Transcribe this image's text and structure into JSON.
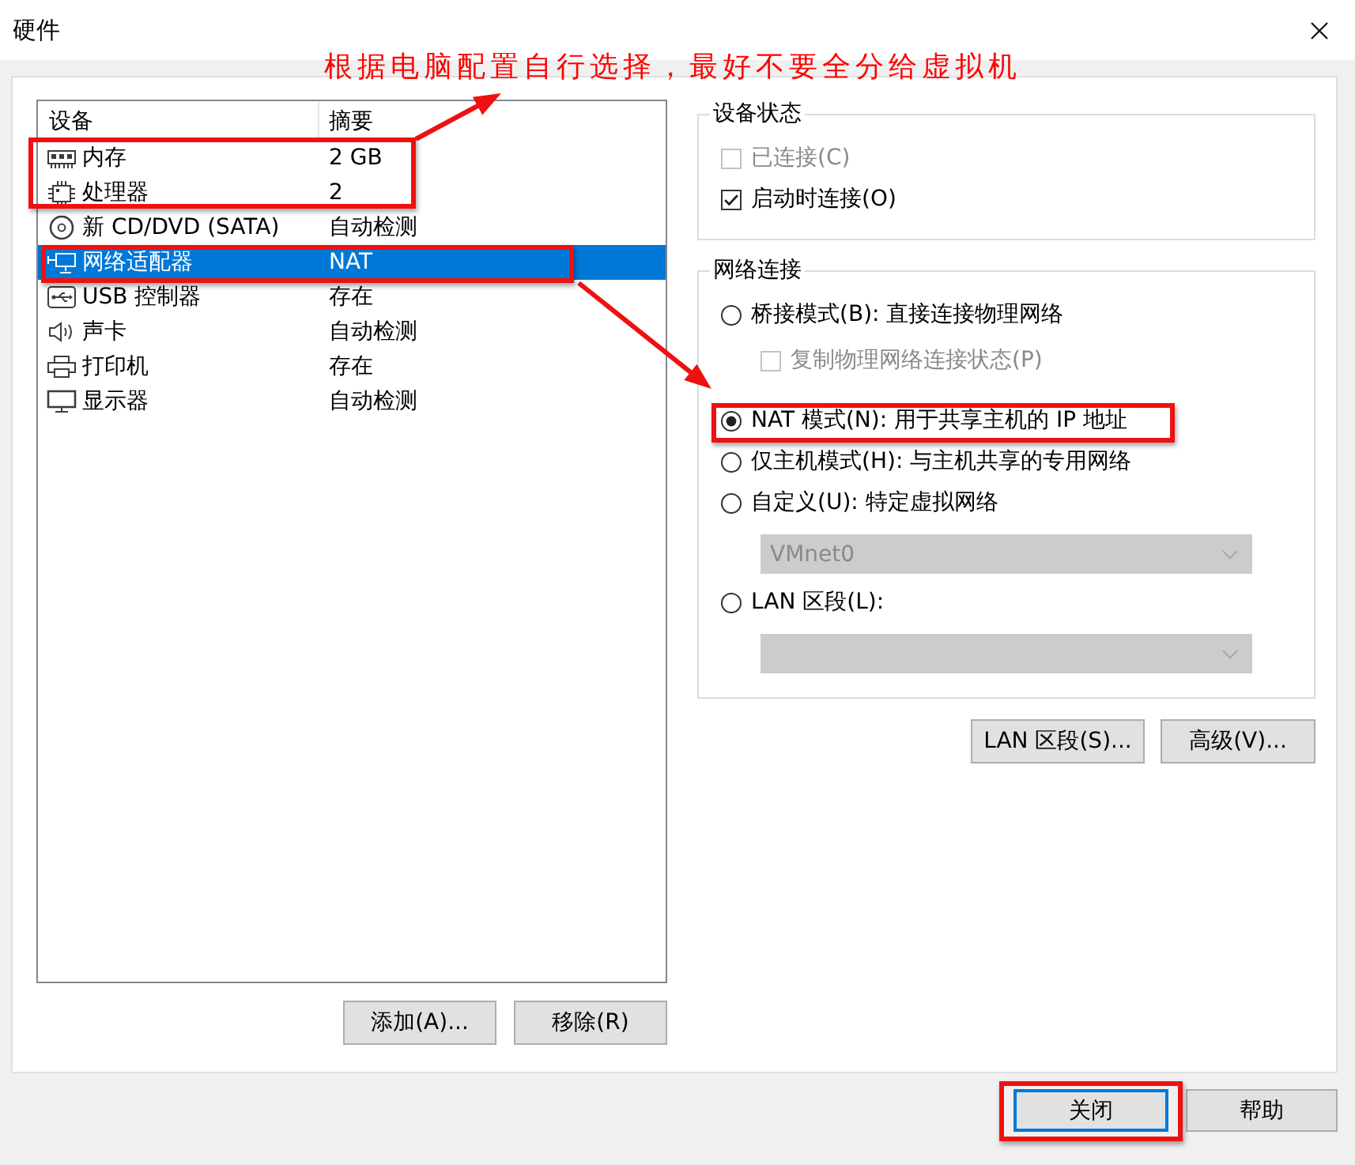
{
  "window": {
    "title": "硬件"
  },
  "annotation": {
    "text": "根据电脑配置自行选择，最好不要全分给虚拟机"
  },
  "devices": {
    "columns": [
      "设备",
      "摘要"
    ],
    "rows": [
      {
        "kind": "memory",
        "name": "内存",
        "summary": "2 GB",
        "selected": false
      },
      {
        "kind": "processor",
        "name": "处理器",
        "summary": "2",
        "selected": false
      },
      {
        "kind": "cdrom",
        "name": "新 CD/DVD (SATA)",
        "summary": "自动检测",
        "selected": false
      },
      {
        "kind": "network",
        "name": "网络适配器",
        "summary": "NAT",
        "selected": true
      },
      {
        "kind": "usb",
        "name": "USB 控制器",
        "summary": "存在",
        "selected": false
      },
      {
        "kind": "sound",
        "name": "声卡",
        "summary": "自动检测",
        "selected": false
      },
      {
        "kind": "printer",
        "name": "打印机",
        "summary": "存在",
        "selected": false
      },
      {
        "kind": "display",
        "name": "显示器",
        "summary": "自动检测",
        "selected": false
      }
    ]
  },
  "device_buttons": [
    "添加(A)...",
    "移除(R)"
  ],
  "device_status": {
    "title": "设备状态",
    "options": [
      {
        "label": "已连接(C)",
        "checked": false,
        "disabled": true
      },
      {
        "label": "启动时连接(O)",
        "checked": true,
        "disabled": false
      }
    ]
  },
  "network_connection": {
    "title": "网络连接",
    "options": [
      {
        "kind": "radio",
        "label": "桥接模式(B): 直接连接物理网络",
        "selected": false,
        "disabled": false,
        "children": [
          {
            "kind": "checkbox",
            "label": "复制物理网络连接状态(P)",
            "checked": false,
            "disabled": true
          }
        ]
      },
      {
        "kind": "radio",
        "label": "NAT 模式(N): 用于共享主机的 IP 地址",
        "selected": true,
        "disabled": false
      },
      {
        "kind": "radio",
        "label": "仅主机模式(H): 与主机共享的专用网络",
        "selected": false,
        "disabled": false
      },
      {
        "kind": "radio",
        "label": "自定义(U): 特定虚拟网络",
        "selected": false,
        "disabled": false,
        "children": [
          {
            "kind": "dropdown",
            "value": "VMnet0",
            "disabled": true
          }
        ]
      },
      {
        "kind": "radio",
        "label": "LAN 区段(L):",
        "selected": false,
        "disabled": false,
        "children": [
          {
            "kind": "dropdown",
            "disabled": true
          }
        ]
      }
    ]
  },
  "network_buttons": [
    "LAN 区段(S)...",
    "高级(V)..."
  ],
  "dialog_buttons": [
    {
      "label": "关闭",
      "default": true
    },
    {
      "label": "帮助",
      "default": false
    }
  ]
}
